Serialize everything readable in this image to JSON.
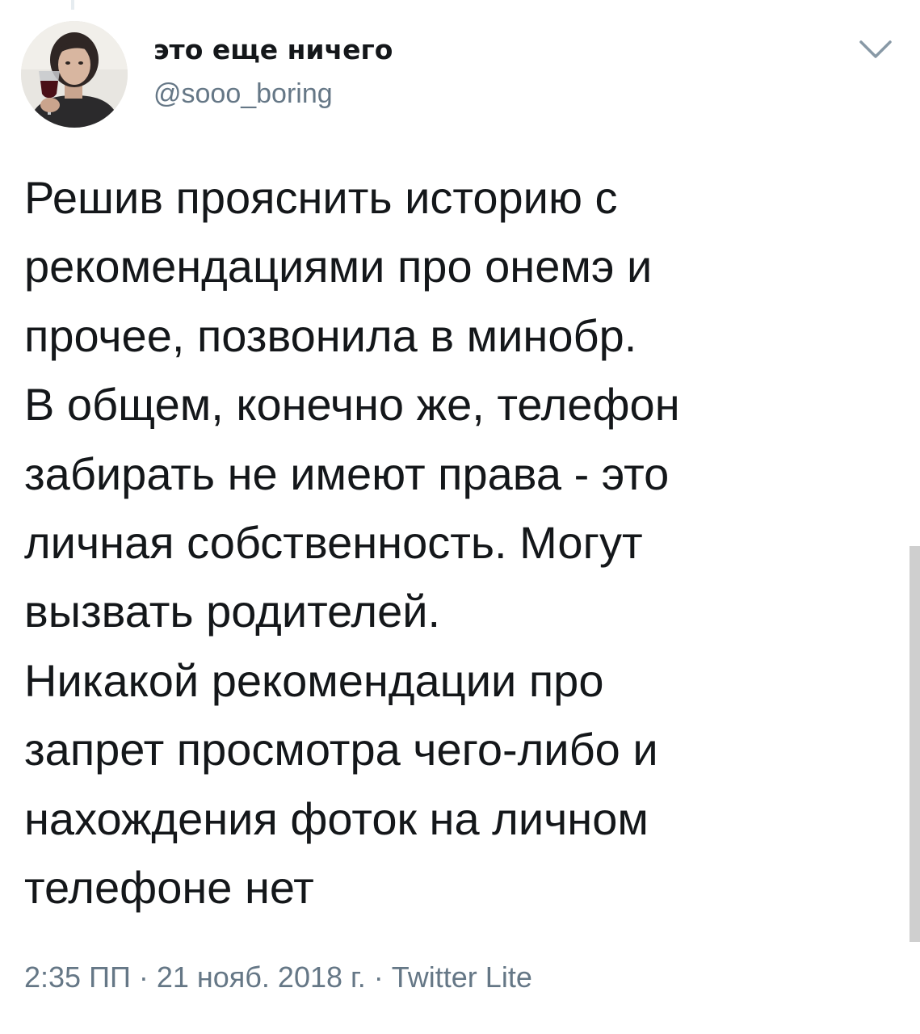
{
  "author": {
    "display_name": "это еще ничего",
    "handle": "@sooo_boring"
  },
  "tweet": {
    "text": "Решив прояснить историю с\nрекомендациями про онемэ и\nпрочее, позвонила в минобр.\nВ общем, конечно же, телефон\nзабирать не имеют права - это\nличная собственность. Могут\nвызвать родителей.\nНикакой рекомендации про\nзапрет просмотра чего-либо и\nнахождения фоток на личном\nтелефоне нет"
  },
  "meta": {
    "time": "2:35 ПП",
    "date": "21 нояб. 2018 г.",
    "separator": "·",
    "source": "Twitter Lite"
  },
  "icons": {
    "menu": "chevron-down-icon"
  },
  "colors": {
    "text": "#14171a",
    "secondary": "#657786"
  }
}
